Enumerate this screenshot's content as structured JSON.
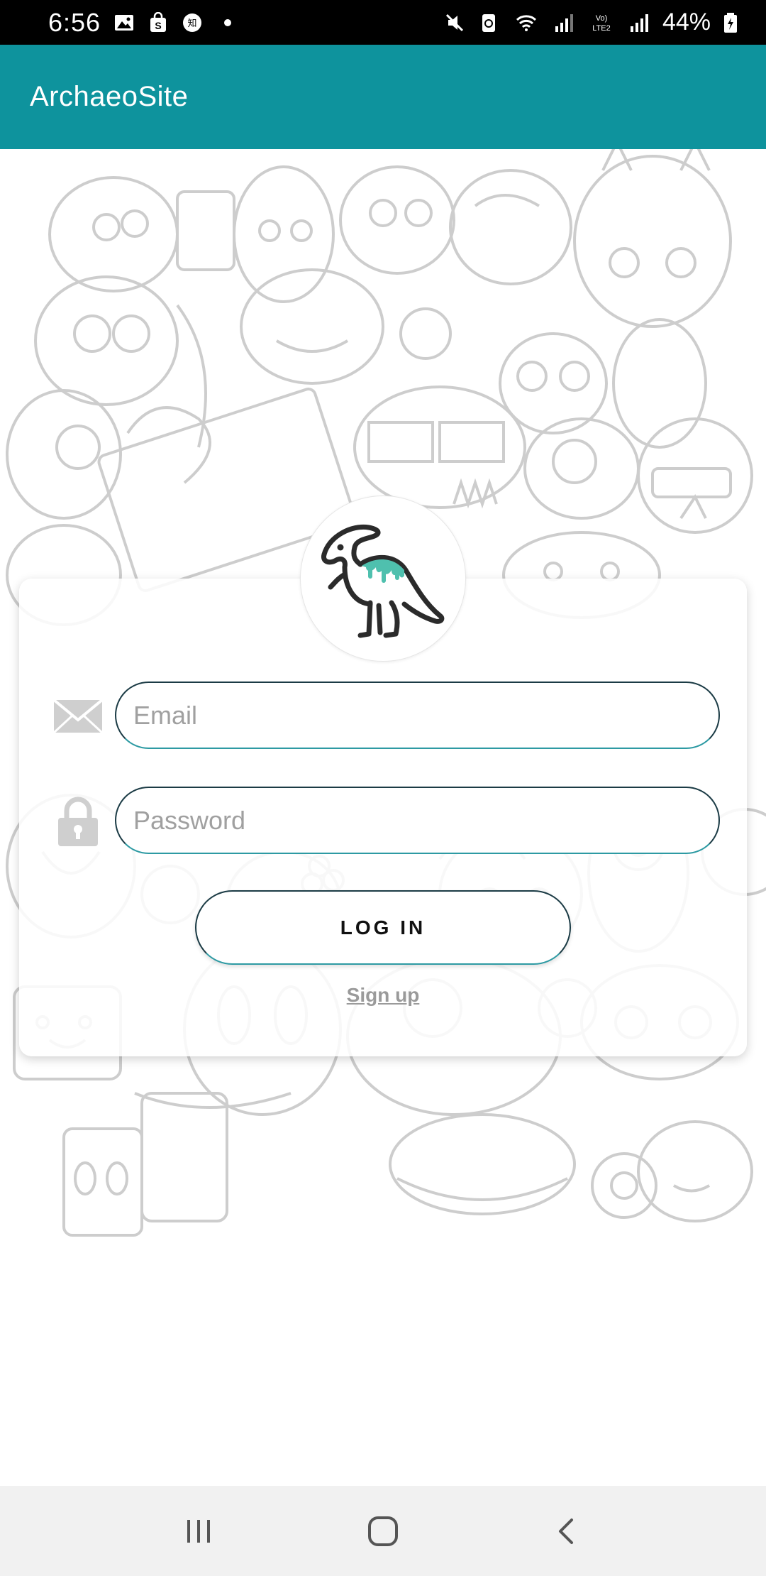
{
  "status_bar": {
    "time": "6:56",
    "battery": "44%",
    "icons_left": [
      "image-icon",
      "shopping-bag-icon",
      "zhihu-icon",
      "dot-icon"
    ],
    "icons_right": [
      "mute-icon",
      "recycle-icon",
      "wifi-icon",
      "signal-icon",
      "volte-icon",
      "signal-icon",
      "battery-icon"
    ],
    "volte_label": "Vo) LTE2"
  },
  "app_bar": {
    "title": "ArchaeoSite"
  },
  "login": {
    "email": {
      "placeholder": "Email",
      "value": ""
    },
    "password": {
      "placeholder": "Password",
      "value": ""
    },
    "login_button": "LOG IN",
    "signup_link": "Sign up"
  },
  "colors": {
    "accent": "#0e939d",
    "dino_teal": "#4fc0ae",
    "input_border": "#1b3b45"
  },
  "nav": {
    "items": [
      "recent-apps-icon",
      "home-icon",
      "back-icon"
    ]
  }
}
